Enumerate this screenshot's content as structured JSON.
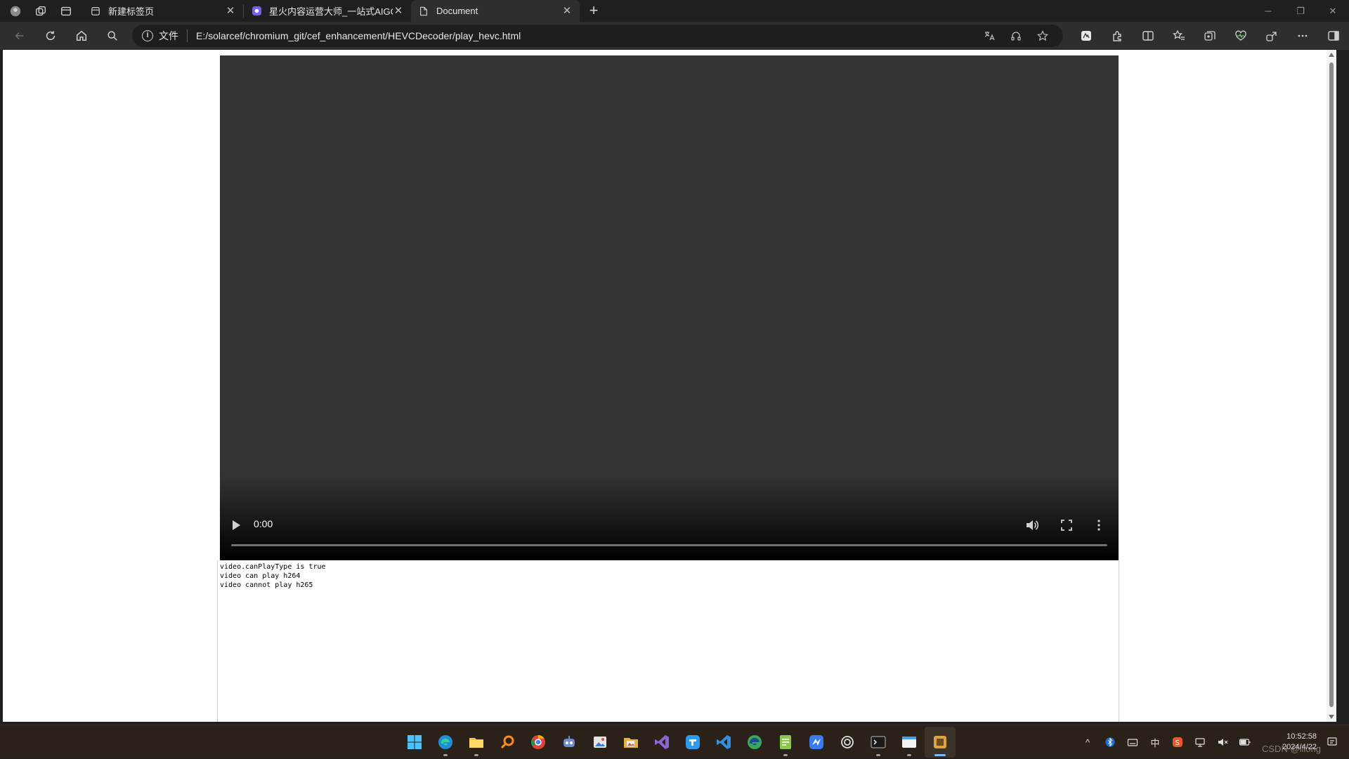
{
  "browser": {
    "tabs": [
      {
        "title": "新建标签页",
        "active": false
      },
      {
        "title": "星火内容运营大师_一站式AIGC平",
        "active": false
      },
      {
        "title": "Document",
        "active": true
      }
    ],
    "address": {
      "scheme_label": "文件",
      "url": "E:/solarcef/chromium_git/cef_enhancement/HEVCDecoder/play_hevc.html"
    }
  },
  "page": {
    "video": {
      "time": "0:00"
    },
    "log": {
      "lines": [
        "video.canPlayType is true",
        "video can play h264",
        "video cannot play h265"
      ]
    }
  },
  "taskbar": {
    "clock_time": "10:52:58",
    "clock_date": "2024/4/22",
    "ime": "中",
    "watermark": "CSDN @lllong"
  },
  "colors": {
    "tabstrip": "#1f1f1f",
    "toolbar": "#2e2e2e",
    "video_bg": "#333333",
    "taskbar": "#2a2118"
  }
}
